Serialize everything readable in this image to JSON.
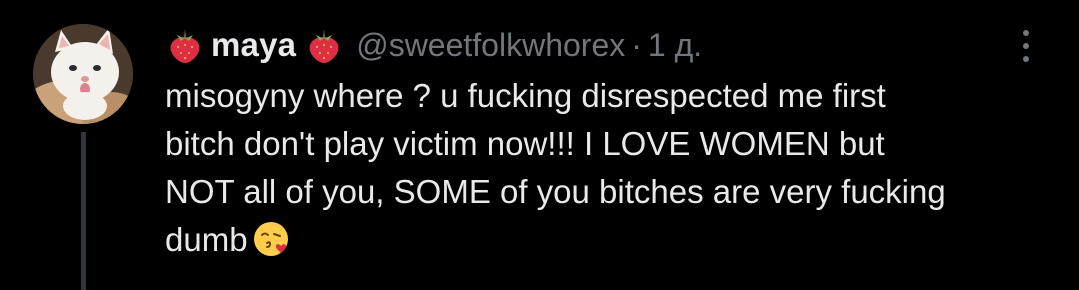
{
  "tweet": {
    "display_name": "maya",
    "name_emoji_left": "strawberry-icon",
    "name_emoji_right": "strawberry-icon",
    "handle": "@sweetfolkwhorex",
    "separator": "·",
    "time": "1 д.",
    "text_lines": [
      "misogyny where ? u fucking disrespected me first",
      "bitch don't play victim now!!! I LOVE WOMEN but",
      "NOT all of you, SOME of you bitches are very fucking",
      "dumb"
    ],
    "text_trailing_emoji": "face-blowing-kiss-icon",
    "more_menu_icon": "more-vertical-icon"
  },
  "colors": {
    "background": "#000000",
    "primary_text": "#e7e9ea",
    "secondary_text": "#71767b",
    "thread_line": "#333639"
  }
}
